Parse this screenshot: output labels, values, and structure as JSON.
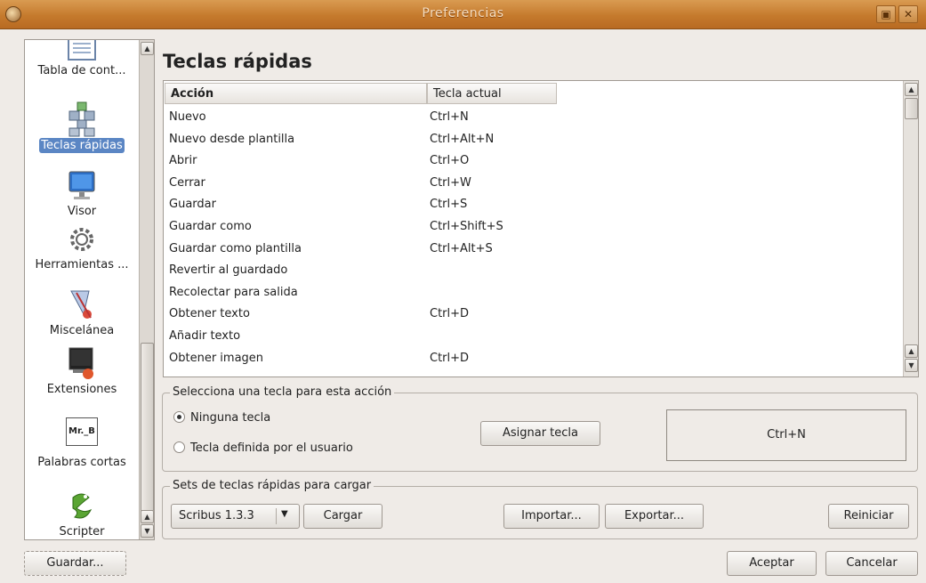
{
  "window": {
    "title": "Preferencias",
    "icon": "app-icon",
    "maximize_glyph": "▣",
    "close_glyph": "✕"
  },
  "sidebar": {
    "items": [
      {
        "label": "Tabla de cont...",
        "icon": "table-of-contents-icon"
      },
      {
        "label": "Teclas rápidas",
        "icon": "keyboard-shortcuts-icon",
        "selected": true
      },
      {
        "label": "Visor",
        "icon": "display-monitor-icon"
      },
      {
        "label": "Herramientas ...",
        "icon": "tools-gear-icon"
      },
      {
        "label": "Miscelánea",
        "icon": "miscellaneous-icon"
      },
      {
        "label": "Extensiones",
        "icon": "extensions-icon"
      },
      {
        "label": "Palabras cortas",
        "icon": "short-words-icon",
        "icon_text": "Mr._B"
      },
      {
        "label": "Scripter",
        "icon": "python-scripter-icon"
      }
    ]
  },
  "page_title": "Teclas rápidas",
  "table": {
    "headers": [
      "Acción",
      "Tecla actual"
    ],
    "rows": [
      {
        "action": "Nuevo",
        "key": "Ctrl+N"
      },
      {
        "action": "Nuevo desde plantilla",
        "key": "Ctrl+Alt+N"
      },
      {
        "action": "Abrir",
        "key": "Ctrl+O"
      },
      {
        "action": "Cerrar",
        "key": "Ctrl+W"
      },
      {
        "action": "Guardar",
        "key": "Ctrl+S"
      },
      {
        "action": "Guardar como",
        "key": "Ctrl+Shift+S"
      },
      {
        "action": "Guardar como plantilla",
        "key": "Ctrl+Alt+S"
      },
      {
        "action": "Revertir al guardado",
        "key": ""
      },
      {
        "action": "Recolectar para salida",
        "key": ""
      },
      {
        "action": "Obtener texto",
        "key": "Ctrl+D"
      },
      {
        "action": "Añadir texto",
        "key": ""
      },
      {
        "action": "Obtener imagen",
        "key": "Ctrl+D"
      }
    ]
  },
  "key_group": {
    "legend": "Selecciona una tecla para esta acción",
    "radio_none": "Ninguna tecla",
    "radio_user": "Tecla definida por el usuario",
    "assign_button": "Asignar tecla",
    "current_key": "Ctrl+N"
  },
  "sets_group": {
    "legend": "Sets de teclas rápidas para cargar",
    "selected_set": "Scribus 1.3.3",
    "load_button": "Cargar",
    "import_button": "Importar...",
    "export_button": "Exportar...",
    "reset_button": "Reiniciar"
  },
  "footer": {
    "save_button": "Guardar...",
    "accept_button": "Aceptar",
    "cancel_button": "Cancelar"
  }
}
